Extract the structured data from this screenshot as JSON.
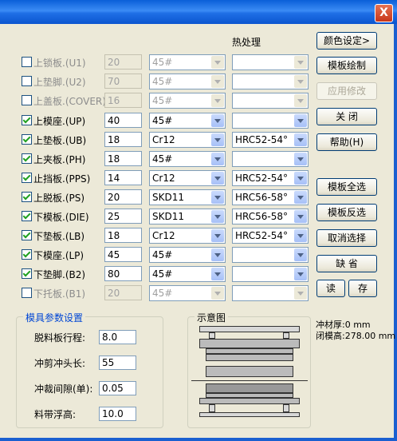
{
  "window": {
    "close_label": "X"
  },
  "header": {
    "heat_treatment": "热处理"
  },
  "rows": [
    {
      "label": "上锁板.(U1)",
      "checked": false,
      "enabled": false,
      "thickness": "20",
      "material": "45#",
      "heat": ""
    },
    {
      "label": "上垫脚.(U2)",
      "checked": false,
      "enabled": false,
      "thickness": "70",
      "material": "45#",
      "heat": ""
    },
    {
      "label": "上盖板.(COVER)",
      "checked": false,
      "enabled": false,
      "thickness": "16",
      "material": "45#",
      "heat": ""
    },
    {
      "label": "上模座.(UP)",
      "checked": true,
      "enabled": true,
      "thickness": "40",
      "material": "45#",
      "heat": ""
    },
    {
      "label": "上垫板.(UB)",
      "checked": true,
      "enabled": true,
      "thickness": "18",
      "material": "Cr12",
      "heat": "HRC52-54°"
    },
    {
      "label": "上夹板.(PH)",
      "checked": true,
      "enabled": true,
      "thickness": "18",
      "material": "45#",
      "heat": ""
    },
    {
      "label": "止挡板.(PPS)",
      "checked": true,
      "enabled": true,
      "thickness": "14",
      "material": "Cr12",
      "heat": "HRC52-54°"
    },
    {
      "label": "上脱板.(PS)",
      "checked": true,
      "enabled": true,
      "thickness": "20",
      "material": "SKD11",
      "heat": "HRC56-58°"
    },
    {
      "label": "下模板.(DIE)",
      "checked": true,
      "enabled": true,
      "thickness": "25",
      "material": "SKD11",
      "heat": "HRC56-58°"
    },
    {
      "label": "下垫板.(LB)",
      "checked": true,
      "enabled": true,
      "thickness": "18",
      "material": "Cr12",
      "heat": "HRC52-54°"
    },
    {
      "label": "下模座.(LP)",
      "checked": true,
      "enabled": true,
      "thickness": "45",
      "material": "45#",
      "heat": ""
    },
    {
      "label": "下垫脚.(B2)",
      "checked": true,
      "enabled": true,
      "thickness": "80",
      "material": "45#",
      "heat": ""
    },
    {
      "label": "下托板.(B1)",
      "checked": false,
      "enabled": false,
      "thickness": "20",
      "material": "45#",
      "heat": ""
    }
  ],
  "buttons": {
    "color_settings": "颜色设定>",
    "draw_plates": "模板绘制",
    "apply_changes": "应用修改",
    "close": "关 闭",
    "help": "帮助(H)",
    "select_all": "模板全选",
    "invert_selection": "模板反选",
    "deselect": "取消选择",
    "default": "缺 省",
    "read": "读",
    "save": "存"
  },
  "params": {
    "title": "模具参数设置",
    "stripper_travel_label": "脱料板行程:",
    "stripper_travel": "8.0",
    "punch_length_label": "冲剪冲头长:",
    "punch_length": "55",
    "clearance_label": "冲裁间隙(单):",
    "clearance": "0.05",
    "strip_lift_label": "料带浮高:",
    "strip_lift": "10.0"
  },
  "diagram": {
    "title": "示意图"
  },
  "info": {
    "material_thickness": "冲材厚:0 mm",
    "closed_height": "闭模高:278.00 mm"
  }
}
